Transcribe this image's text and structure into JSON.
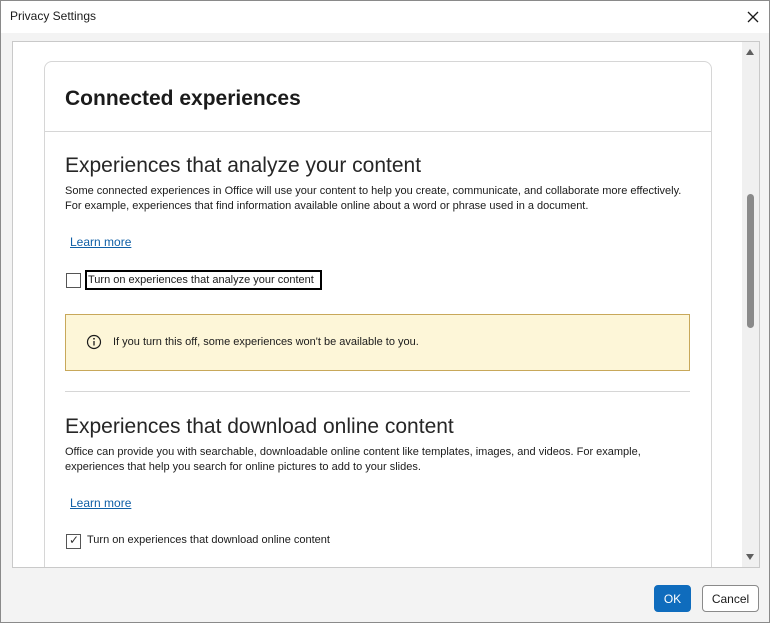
{
  "window": {
    "title": "Privacy Settings"
  },
  "card": {
    "title": "Connected experiences"
  },
  "sections": [
    {
      "heading": "Experiences that analyze your content",
      "description": "Some connected experiences in Office will use your content to help you create, communicate, and collaborate more effectively. For example, experiences that find information available online about a word or phrase used in a document.",
      "learn_more": "Learn more",
      "checkbox_label": "Turn on experiences that analyze your content",
      "checked": false,
      "info_text": "If you turn this off, some experiences won't be available to you."
    },
    {
      "heading": "Experiences that download online content",
      "description": "Office can provide you with searchable, downloadable online content like templates, images, and videos. For example, experiences that help you search for online pictures to add to your slides.",
      "learn_more": "Learn more",
      "checkbox_label": "Turn on experiences that download online content",
      "checked": true,
      "check_glyph": "✓"
    }
  ],
  "footer": {
    "ok_label": "OK",
    "cancel_label": "Cancel"
  },
  "colors": {
    "accent": "#0f6cbd",
    "link": "#0f5fa6",
    "info_bg": "#fdf6d8",
    "info_border": "#c8a85a"
  },
  "icons": {
    "close": "close-icon",
    "info": "info-icon",
    "scroll_up": "chevron-up-icon",
    "scroll_down": "chevron-down-icon"
  }
}
